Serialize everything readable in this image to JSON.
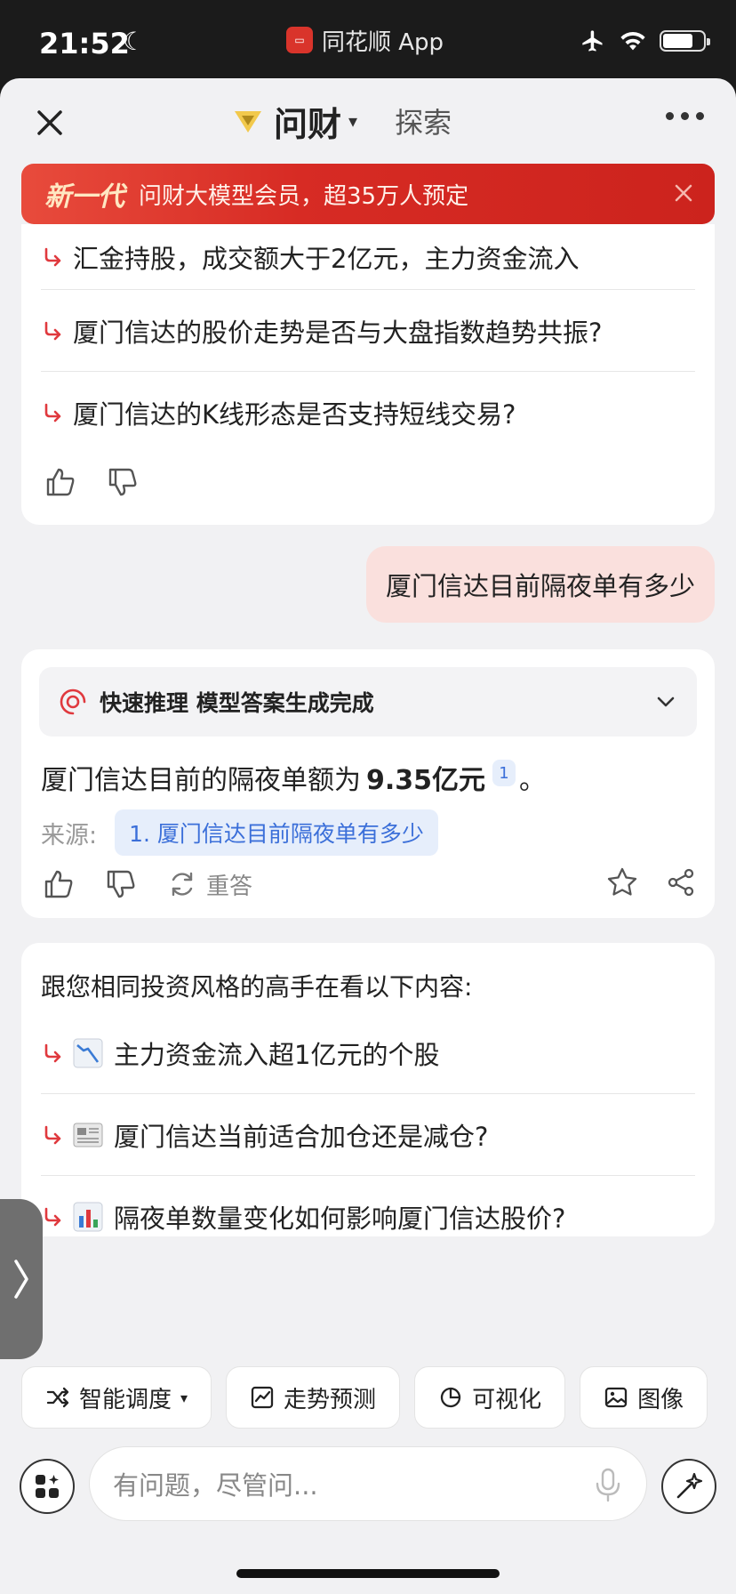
{
  "status_bar": {
    "time": "21:52",
    "app_name": "同花顺 App",
    "battery_level": 0.75
  },
  "nav": {
    "title": "问财",
    "explore": "探索"
  },
  "promo": {
    "tag": "新一代",
    "text": "问财大模型会员，超35万人预定"
  },
  "suggestions_top": [
    {
      "text": "汇金持股，成交额大于2亿元，主力资金流入"
    },
    {
      "text": "厦门信达的股价走势是否与大盘指数趋势共振?"
    },
    {
      "text": "厦门信达的K线形态是否支持短线交易?"
    }
  ],
  "user_message": "厦门信达目前隔夜单有多少",
  "answer": {
    "reasoning_status": "快速推理 模型答案生成完成",
    "text_prefix": "厦门信达目前的隔夜单额为",
    "value": "9.35亿元",
    "ref_number": "1",
    "text_suffix": "。",
    "source_label": "来源:",
    "source_link": "1. 厦门信达目前隔夜单有多少",
    "retry_label": "重答"
  },
  "recommend": {
    "title": "跟您相同投资风格的高手在看以下内容:",
    "items": [
      {
        "icon": "chart-down-icon",
        "text": "主力资金流入超1亿元的个股"
      },
      {
        "icon": "newspaper-icon",
        "text": "厦门信达当前适合加仓还是减仓?"
      },
      {
        "icon": "bar-chart-icon",
        "text": "隔夜单数量变化如何影响厦门信达股价?"
      }
    ]
  },
  "toolbar": [
    {
      "label": "智能调度",
      "icon": "shuffle-icon"
    },
    {
      "label": "走势预测",
      "icon": "trend-icon"
    },
    {
      "label": "可视化",
      "icon": "pie-icon"
    },
    {
      "label": "图像",
      "icon": "image-icon"
    }
  ],
  "composer": {
    "placeholder": "有问题，尽管问..."
  },
  "colors": {
    "accent_red": "#d72b24",
    "link_blue": "#3b6fd9",
    "bubble_pink": "#fae0dd"
  }
}
